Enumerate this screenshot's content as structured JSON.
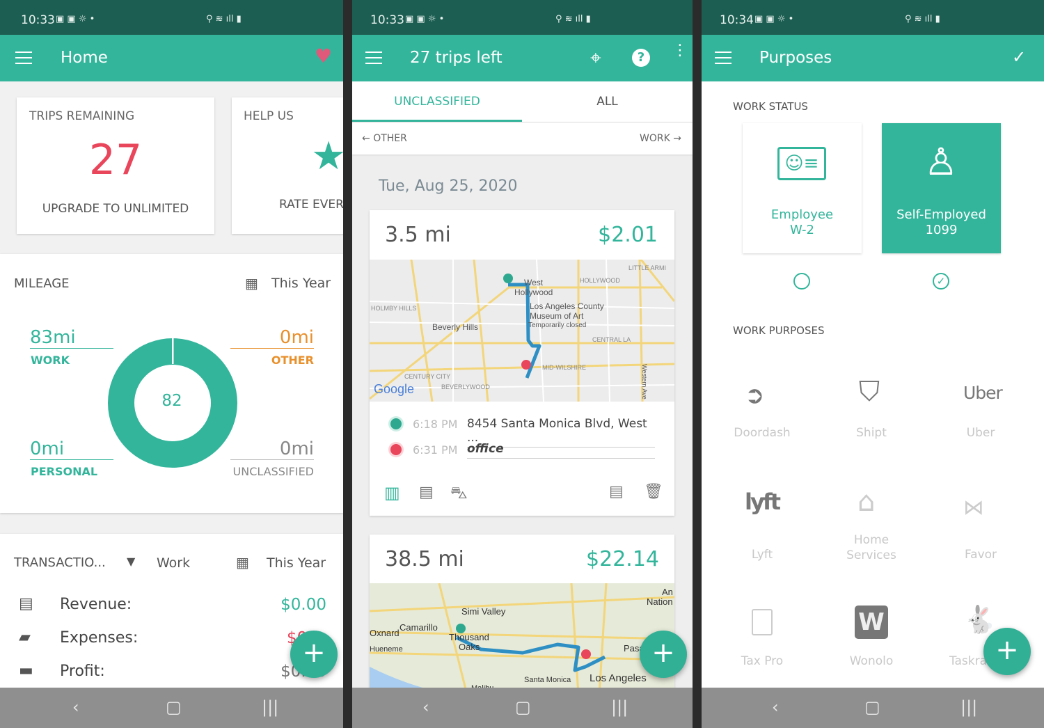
{
  "colors": {
    "primary": "#33b59b",
    "status_bar": "#1d5e52",
    "accent_red": "#e9455b",
    "other_orange": "#e8902c"
  },
  "screens": [
    {
      "status": {
        "time": "10:33"
      },
      "appbar": {
        "title": "Home",
        "action_icon": "heart-icon"
      },
      "trips_card": {
        "label": "TRIPS REMAINING",
        "count": "27",
        "link": "UPGRADE TO UNLIMITED"
      },
      "help_card": {
        "label": "HELP US",
        "link": "RATE EVER"
      },
      "mileage": {
        "title": "MILEAGE",
        "period": "This Year",
        "total": "82",
        "work": {
          "value": "83mi",
          "label": "WORK"
        },
        "other": {
          "value": "0mi",
          "label": "OTHER"
        },
        "personal": {
          "value": "0mi",
          "label": "PERSONAL"
        },
        "unclassified": {
          "value": "0mi",
          "label": "UNCLASSIFIED"
        }
      },
      "transactions": {
        "title": "TRANSACTIO...",
        "filter": "Work",
        "period": "This Year",
        "rows": [
          {
            "label": "Revenue:",
            "value": "$0.00",
            "icon": "cash-icon"
          },
          {
            "label": "Expenses:",
            "value": "$0",
            "icon": "card-payment-icon"
          },
          {
            "label": "Profit:",
            "value": "$0.00",
            "icon": "wallet-icon"
          }
        ]
      }
    },
    {
      "status": {
        "time": "10:33"
      },
      "appbar": {
        "title": "27 trips left"
      },
      "tabs": [
        {
          "label": "UNCLASSIFIED",
          "active": true
        },
        {
          "label": "ALL",
          "active": false
        }
      ],
      "swipe": {
        "left": "OTHER",
        "right": "WORK"
      },
      "date": "Tue, Aug 25, 2020",
      "trips": [
        {
          "distance": "3.5 mi",
          "amount": "$2.01",
          "start": {
            "time": "6:18 PM",
            "place": "8454 Santa Monica Blvd, West ..."
          },
          "end": {
            "time": "6:31 PM",
            "place": "office"
          },
          "map_labels": [
            "West",
            "Hollywood",
            "HOLLYWOOD",
            "LITTLE ARMI",
            "Los Angeles County",
            "Museum of Art",
            "Temporarily closed",
            "HOLMBY HILLS",
            "Beverly Hills",
            "CENTRAL LA",
            "MID-WILSHIRE",
            "CENTURY CITY",
            "BEVERLYWOOD",
            "Western Ave",
            "Google"
          ]
        },
        {
          "distance": "38.5 mi",
          "amount": "$22.14",
          "map_labels": [
            "Simi Valley",
            "Camarillo",
            "Oxnard",
            "Thousand",
            "Oaks",
            "Hueneme",
            "Los Angeles",
            "Pasadena",
            "Malibu",
            "Santa Monica",
            "An",
            "Nation"
          ]
        }
      ]
    },
    {
      "status": {
        "time": "10:34"
      },
      "appbar": {
        "title": "Purposes"
      },
      "work_status": {
        "heading": "WORK STATUS",
        "options": [
          {
            "line1": "Employee",
            "line2": "W-2",
            "selected": false
          },
          {
            "line1": "Self-Employed",
            "line2": "1099",
            "selected": true
          }
        ]
      },
      "work_purposes": {
        "heading": "WORK PURPOSES",
        "items": [
          "Doordash",
          "Shipt",
          "Uber",
          "Lyft",
          "Home Services",
          "Favor",
          "Tax Pro",
          "Wonolo",
          "Taskra"
        ]
      }
    }
  ],
  "nav": {
    "back": "‹",
    "home": "▢",
    "recents": "|||"
  }
}
